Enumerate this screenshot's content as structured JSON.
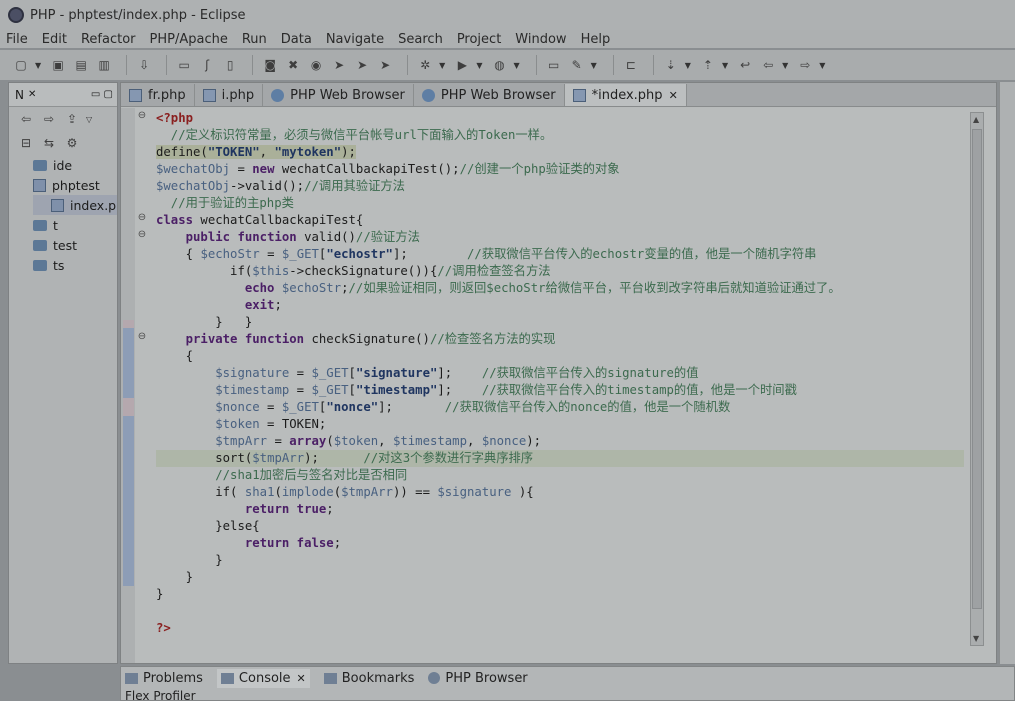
{
  "window": {
    "title": "PHP - phptest/index.php - Eclipse"
  },
  "menu": [
    "File",
    "Edit",
    "Refactor",
    "PHP/Apache",
    "Run",
    "Data",
    "Navigate",
    "Search",
    "Project",
    "Window",
    "Help"
  ],
  "left_panel": {
    "tab_label": "N",
    "tree": [
      {
        "label": "ide",
        "type": "folder",
        "level": 0
      },
      {
        "label": "phptest",
        "type": "project",
        "level": 0
      },
      {
        "label": "index.p",
        "type": "file",
        "level": 1,
        "selected": true
      },
      {
        "label": "t",
        "type": "folder",
        "level": 0
      },
      {
        "label": "test",
        "type": "folder",
        "level": 0
      },
      {
        "label": "ts",
        "type": "folder",
        "level": 0
      }
    ]
  },
  "editor_tabs": [
    {
      "label": "fr.php",
      "icon": "php-file-icon"
    },
    {
      "label": "i.php",
      "icon": "php-file-icon"
    },
    {
      "label": "PHP Web Browser",
      "icon": "globe-icon"
    },
    {
      "label": "PHP Web Browser",
      "icon": "globe-icon"
    },
    {
      "label": "*index.php",
      "icon": "php-file-icon",
      "active": true
    }
  ],
  "code": {
    "l1": "<?php",
    "l2": "  //定义标识符常量，必须与微信平台帐号url下面输入的Token一样。",
    "l3a": "define(",
    "l3b": "\"TOKEN\"",
    "l3c": ", ",
    "l3d": "\"mytoken\"",
    "l3e": ");",
    "l4a": "$wechatObj",
    "l4b": " = ",
    "l4c": "new",
    "l4d": " wechatCallbackapiTest();",
    "l4e": "//创建一个php验证类的对象",
    "l5a": "$wechatObj",
    "l5b": "->valid();",
    "l5c": "//调用其验证方法",
    "l6": "  //用于验证的主php类",
    "l7a": "class",
    "l7b": " wechatCallbackapiTest{",
    "l8a": "public",
    "l8b": "function",
    "l8c": " valid()",
    "l8d": "//验证方法",
    "l9a": "{ ",
    "l9b": "$echoStr",
    "l9c": " = ",
    "l9d": "$_GET",
    "l9e": "[",
    "l9f": "\"echostr\"",
    "l9g": "];",
    "l9h": "//获取微信平台传入的echostr变量的值，他是一个随机字符串",
    "l10a": "if(",
    "l10b": "$this",
    "l10c": "->checkSignature()){",
    "l10d": "//调用检查签名方法",
    "l11a": "echo",
    "l11b": "$echoStr",
    "l11c": ";",
    "l11d": "//如果验证相同，则返回$echoStr给微信平台，平台收到改字符串后就知道验证通过了。",
    "l12a": "exit",
    "l12b": ";",
    "l13": "}   }",
    "l14a": "private",
    "l14b": "function",
    "l14c": " checkSignature()",
    "l14d": "//检查签名方法的实现",
    "l15": "{",
    "l16a": "$signature",
    "l16b": " = ",
    "l16c": "$_GET",
    "l16d": "[",
    "l16e": "\"signature\"",
    "l16f": "];",
    "l16g": "//获取微信平台传入的signature的值",
    "l17a": "$timestamp",
    "l17b": " = ",
    "l17c": "$_GET",
    "l17d": "[",
    "l17e": "\"timestamp\"",
    "l17f": "];",
    "l17g": "//获取微信平台传入的timestamp的值，他是一个时间戳",
    "l18a": "$nonce",
    "l18b": " = ",
    "l18c": "$_GET",
    "l18d": "[",
    "l18e": "\"nonce\"",
    "l18f": "];",
    "l18g": "//获取微信平台传入的nonce的值，他是一个随机数",
    "l19a": "$token",
    "l19b": " = TOKEN;",
    "l20a": "$tmpArr",
    "l20b": " = ",
    "l20c": "array",
    "l20d": "(",
    "l20e": "$token",
    "l20f": ", ",
    "l20g": "$timestamp",
    "l20h": ", ",
    "l20i": "$nonce",
    "l20j": ");",
    "l21a": "sort(",
    "l21b": "$tmpArr",
    "l21c": ");",
    "l21d": "//对这3个参数进行字典序排序",
    "l22": "//sha1加密后与签名对比是否相同",
    "l23a": "if( ",
    "l23b": "sha1",
    "l23c": "(",
    "l23d": "implode",
    "l23e": "(",
    "l23f": "$tmpArr",
    "l23g": ")) == ",
    "l23h": "$signature",
    "l23i": " ){",
    "l24a": "return",
    "l24b": "true",
    "l24c": ";",
    "l25": "}else{",
    "l26a": "return",
    "l26b": "false",
    "l26c": ";",
    "l27": "}",
    "l28": "}",
    "l29": "}",
    "l30": "?>"
  },
  "bottom_tabs": [
    {
      "label": "Problems",
      "icon": "problems-icon"
    },
    {
      "label": "Console",
      "icon": "console-icon",
      "active": true
    },
    {
      "label": "Bookmarks",
      "icon": "bookmarks-icon"
    },
    {
      "label": "PHP Browser",
      "icon": "globe-icon"
    }
  ],
  "bottom_content": "Flex Profiler"
}
